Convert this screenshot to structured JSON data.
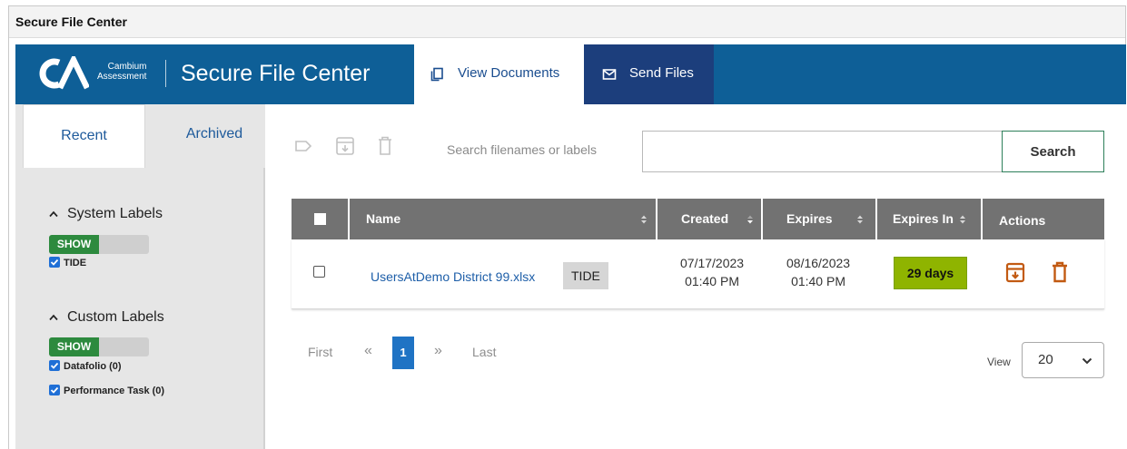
{
  "window": {
    "title": "Secure File Center"
  },
  "brand": {
    "logo_line1": "Cambium",
    "logo_line2": "Assessment",
    "app_title": "Secure File Center"
  },
  "tabs": [
    {
      "label": "View Documents",
      "icon": "copy-icon",
      "active": true
    },
    {
      "label": "Send Files",
      "icon": "envelope-icon",
      "active": false
    }
  ],
  "sidebar": {
    "tabs": [
      "Recent",
      "Archived"
    ],
    "system_labels": {
      "heading": "System Labels",
      "toggle": "SHOW",
      "items": [
        {
          "label": "TIDE",
          "checked": true
        }
      ]
    },
    "custom_labels": {
      "heading": "Custom Labels",
      "toggle": "SHOW",
      "items": [
        {
          "label": "Datafolio (0)",
          "checked": true
        },
        {
          "label": "Performance Task (0)",
          "checked": true
        }
      ]
    }
  },
  "toolbar": {
    "icons": [
      "tag-icon",
      "archive-icon",
      "trash-icon"
    ]
  },
  "search": {
    "prompt": "Search filenames or labels",
    "value": "",
    "button": "Search"
  },
  "table": {
    "columns": [
      "Name",
      "Created",
      "Expires",
      "Expires In",
      "Actions"
    ],
    "rows": [
      {
        "name": "UsersAtDemo District 99.xlsx",
        "tag": "TIDE",
        "created_date": "07/17/2023",
        "created_time": "01:40 PM",
        "expires_date": "08/16/2023",
        "expires_time": "01:40 PM",
        "expires_in": "29 days",
        "actions": [
          "archive-icon",
          "trash-icon"
        ]
      }
    ]
  },
  "pagination": {
    "first": "First",
    "prev": "«",
    "current": "1",
    "next": "»",
    "last": "Last"
  },
  "page_size": {
    "label": "View",
    "value": "20"
  },
  "colors": {
    "brand_blue": "#0e5f97",
    "send_tab": "#1c3e7c",
    "badge_green": "#8fb400",
    "toggle_green": "#2d8a3e",
    "action_orange": "#c25a12",
    "page_active": "#1f73c4"
  }
}
